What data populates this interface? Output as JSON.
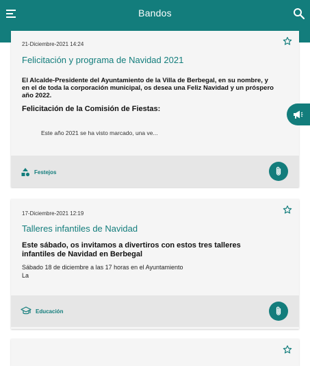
{
  "header": {
    "title": "Bandos",
    "menu_icon": "menu-icon",
    "search_icon": "search-icon",
    "color": "#137d7c"
  },
  "cards": [
    {
      "date": "21-Diciembre-2021 14:24",
      "title": "Felicitación y programa de Navidad 2021",
      "body_lines": [
        "El Alcalde-Presidente del Ayuntamiento de la Villa de Berbegal, en su nombre, y",
        "en el de toda la corporación municipal, os desea una Feliz Navidad y un próspero",
        "año 2022."
      ],
      "subheading": "Felicitación de la Comisión de Fiestas:",
      "excerpt": "Este año 2021 se ha visto marcado, una ve...",
      "category": "Festejos",
      "category_icon": "shapes-icon",
      "attachment_icon": "paperclip-icon"
    },
    {
      "date": "17-Diciembre-2021 12:19",
      "title": "Talleres infantiles de Navidad",
      "lead_lines": [
        "Este sábado, os invitamos a divertiros con estos tres talleres",
        "infantiles de Navidad en Berbegal"
      ],
      "line1": "Sábado 18 de diciembre a las 17 horas en el Ayuntamiento",
      "line2": "La",
      "category": "Educación",
      "category_icon": "graduation-cap-icon",
      "attachment_icon": "paperclip-icon"
    }
  ],
  "side_button_icon": "megaphone-icon"
}
